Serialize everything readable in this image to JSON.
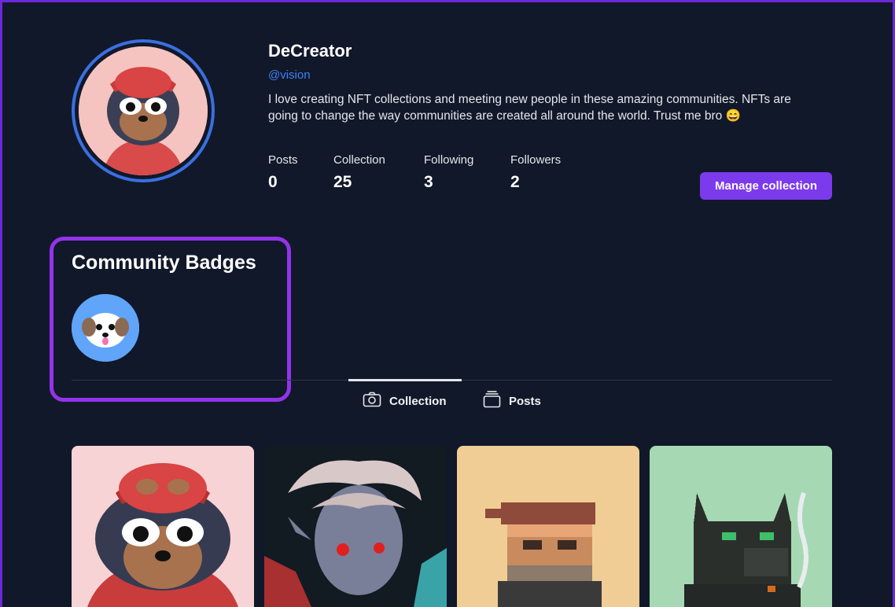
{
  "profile": {
    "name": "DeCreator",
    "handle": "@vision",
    "bio": "I love creating NFT collections and meeting new people in these amazing communities. NFTs are going to change the way communities are created all around the world. Trust me bro 😄"
  },
  "stats": [
    {
      "label": "Posts",
      "value": "0"
    },
    {
      "label": "Collection",
      "value": "25"
    },
    {
      "label": "Following",
      "value": "3"
    },
    {
      "label": "Followers",
      "value": "2"
    }
  ],
  "actions": {
    "manage_label": "Manage collection"
  },
  "badges": {
    "title": "Community Badges"
  },
  "tabs": [
    {
      "label": "Collection",
      "icon": "camera-icon",
      "active": true
    },
    {
      "label": "Posts",
      "icon": "stack-icon",
      "active": false
    }
  ],
  "collection": [
    {
      "name": "dog-with-cap-nft",
      "bg": "#f7d3d5"
    },
    {
      "name": "elf-character-nft",
      "bg": "#121a22"
    },
    {
      "name": "pixel-character-nft",
      "bg": "#f0cd95"
    },
    {
      "name": "pixel-wolf-nft",
      "bg": "#a6d9b3"
    }
  ],
  "colors": {
    "accent": "#7c3aed",
    "link": "#3b82f6",
    "background": "#11182a"
  }
}
